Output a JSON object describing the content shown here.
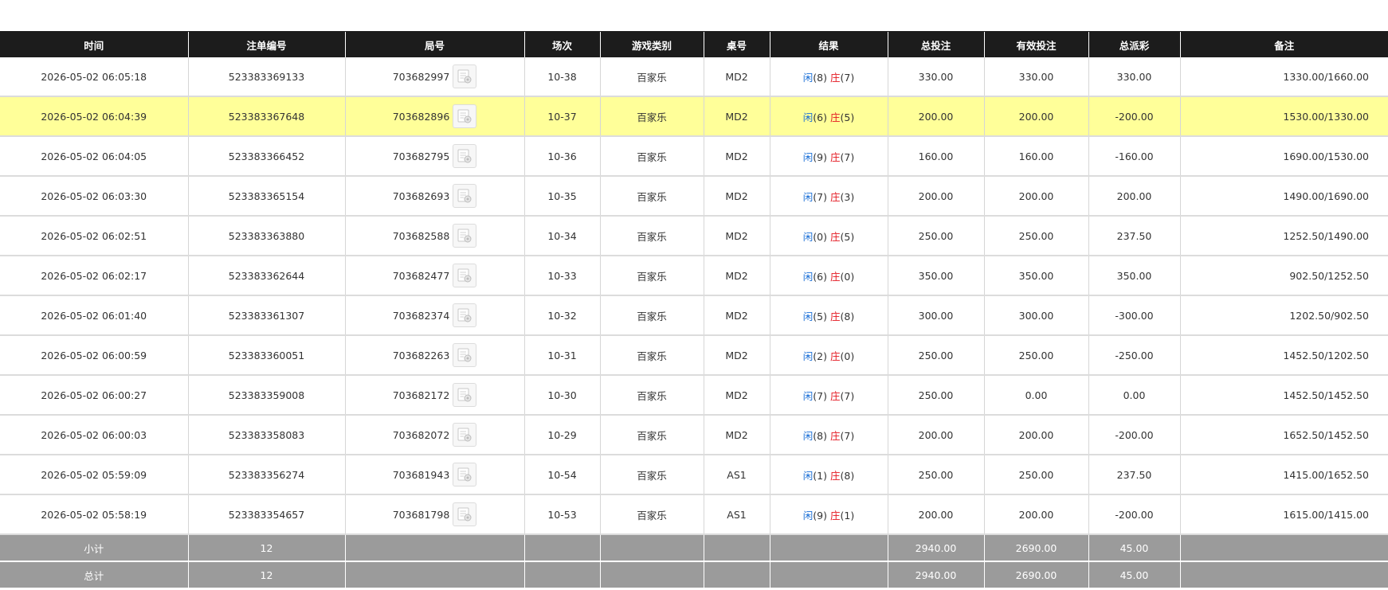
{
  "headers": [
    "时间",
    "注单编号",
    "局号",
    "场次",
    "游戏类别",
    "桌号",
    "结果",
    "总投注",
    "有效投注",
    "总派彩",
    "备注"
  ],
  "result_labels": {
    "player": "闲",
    "banker": "庄"
  },
  "rows": [
    {
      "time": "2026-05-02 06:05:18",
      "bet_no": "523383369133",
      "round": "703682997",
      "session": "10-38",
      "game": "百家乐",
      "table": "MD2",
      "player": "(8)",
      "banker": "(7)",
      "total_bet": "330.00",
      "valid_bet": "330.00",
      "payout": "330.00",
      "payout_negative": false,
      "remark": "1330.00/1660.00"
    },
    {
      "time": "2026-05-02 06:04:39",
      "bet_no": "523383367648",
      "round": "703682896",
      "session": "10-37",
      "game": "百家乐",
      "table": "MD2",
      "player": "(6)",
      "banker": "(5)",
      "total_bet": "200.00",
      "valid_bet": "200.00",
      "payout": "-200.00",
      "payout_negative": true,
      "remark": "1530.00/1330.00",
      "highlight": true
    },
    {
      "time": "2026-05-02 06:04:05",
      "bet_no": "523383366452",
      "round": "703682795",
      "session": "10-36",
      "game": "百家乐",
      "table": "MD2",
      "player": "(9)",
      "banker": "(7)",
      "total_bet": "160.00",
      "valid_bet": "160.00",
      "payout": "-160.00",
      "payout_negative": true,
      "remark": "1690.00/1530.00"
    },
    {
      "time": "2026-05-02 06:03:30",
      "bet_no": "523383365154",
      "round": "703682693",
      "session": "10-35",
      "game": "百家乐",
      "table": "MD2",
      "player": "(7)",
      "banker": "(3)",
      "total_bet": "200.00",
      "valid_bet": "200.00",
      "payout": "200.00",
      "payout_negative": false,
      "remark": "1490.00/1690.00"
    },
    {
      "time": "2026-05-02 06:02:51",
      "bet_no": "523383363880",
      "round": "703682588",
      "session": "10-34",
      "game": "百家乐",
      "table": "MD2",
      "player": "(0)",
      "banker": "(5)",
      "total_bet": "250.00",
      "valid_bet": "250.00",
      "payout": "237.50",
      "payout_negative": false,
      "remark": "1252.50/1490.00"
    },
    {
      "time": "2026-05-02 06:02:17",
      "bet_no": "523383362644",
      "round": "703682477",
      "session": "10-33",
      "game": "百家乐",
      "table": "MD2",
      "player": "(6)",
      "banker": "(0)",
      "total_bet": "350.00",
      "valid_bet": "350.00",
      "payout": "350.00",
      "payout_negative": false,
      "remark": "902.50/1252.50"
    },
    {
      "time": "2026-05-02 06:01:40",
      "bet_no": "523383361307",
      "round": "703682374",
      "session": "10-32",
      "game": "百家乐",
      "table": "MD2",
      "player": "(5)",
      "banker": "(8)",
      "total_bet": "300.00",
      "valid_bet": "300.00",
      "payout": "-300.00",
      "payout_negative": true,
      "remark": "1202.50/902.50"
    },
    {
      "time": "2026-05-02 06:00:59",
      "bet_no": "523383360051",
      "round": "703682263",
      "session": "10-31",
      "game": "百家乐",
      "table": "MD2",
      "player": "(2)",
      "banker": "(0)",
      "total_bet": "250.00",
      "valid_bet": "250.00",
      "payout": "-250.00",
      "payout_negative": true,
      "remark": "1452.50/1202.50"
    },
    {
      "time": "2026-05-02 06:00:27",
      "bet_no": "523383359008",
      "round": "703682172",
      "session": "10-30",
      "game": "百家乐",
      "table": "MD2",
      "player": "(7)",
      "banker": "(7)",
      "total_bet": "250.00",
      "valid_bet": "0.00",
      "payout": "0.00",
      "payout_negative": false,
      "remark": "1452.50/1452.50"
    },
    {
      "time": "2026-05-02 06:00:03",
      "bet_no": "523383358083",
      "round": "703682072",
      "session": "10-29",
      "game": "百家乐",
      "table": "MD2",
      "player": "(8)",
      "banker": "(7)",
      "total_bet": "200.00",
      "valid_bet": "200.00",
      "payout": "-200.00",
      "payout_negative": true,
      "remark": "1652.50/1452.50"
    },
    {
      "time": "2026-05-02 05:59:09",
      "bet_no": "523383356274",
      "round": "703681943",
      "session": "10-54",
      "game": "百家乐",
      "table": "AS1",
      "player": "(1)",
      "banker": "(8)",
      "total_bet": "250.00",
      "valid_bet": "250.00",
      "payout": "237.50",
      "payout_negative": false,
      "remark": "1415.00/1652.50"
    },
    {
      "time": "2026-05-02 05:58:19",
      "bet_no": "523383354657",
      "round": "703681798",
      "session": "10-53",
      "game": "百家乐",
      "table": "AS1",
      "player": "(9)",
      "banker": "(1)",
      "total_bet": "200.00",
      "valid_bet": "200.00",
      "payout": "-200.00",
      "payout_negative": true,
      "remark": "1615.00/1415.00"
    }
  ],
  "subtotal": {
    "label": "小计",
    "count": "12",
    "total_bet": "2940.00",
    "valid_bet": "2690.00",
    "payout": "45.00"
  },
  "total": {
    "label": "总计",
    "count": "12",
    "total_bet": "2940.00",
    "valid_bet": "2690.00",
    "payout": "45.00"
  },
  "colors": {
    "header_bg": "#1c1c1c",
    "highlight_row": "#ffff99",
    "summary_bg": "#9b9b9b",
    "positive_blue": "#1a6fd6",
    "negative_red": "#e4161e"
  }
}
